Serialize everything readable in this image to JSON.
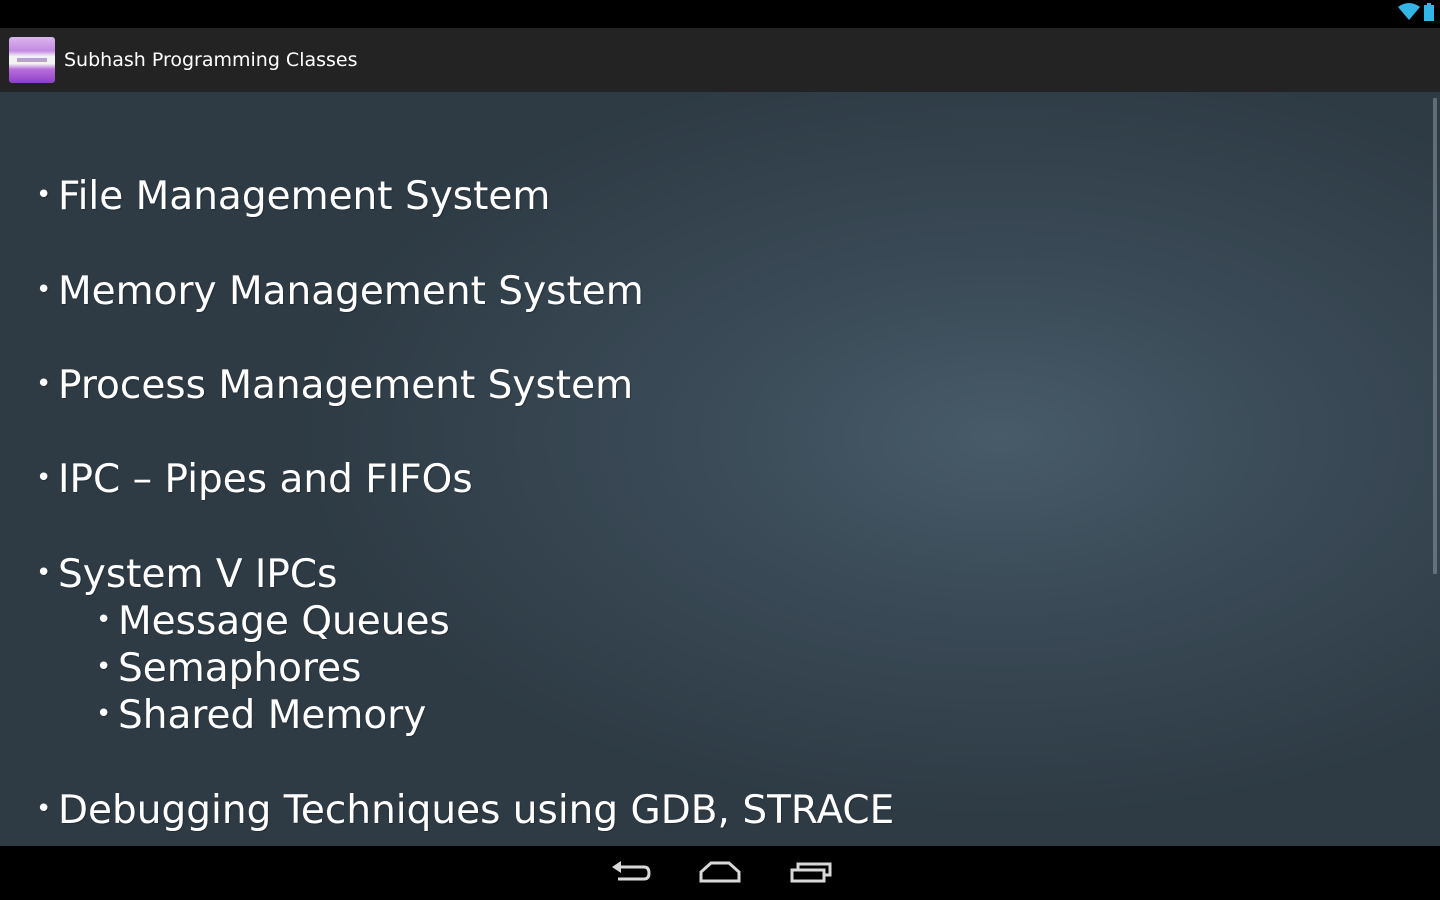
{
  "app": {
    "title": "Subhash Programming Classes"
  },
  "topics": [
    {
      "label": "File Management System"
    },
    {
      "label": "Memory Management System"
    },
    {
      "label": "Process Management System"
    },
    {
      "label": "IPC – Pipes and FIFOs"
    },
    {
      "label": "System V IPCs",
      "children": [
        {
          "label": "Message Queues"
        },
        {
          "label": "Semaphores"
        },
        {
          "label": "Shared Memory"
        }
      ]
    },
    {
      "label": "Debugging Techniques using GDB, STRACE"
    }
  ],
  "bullet": "•",
  "status_bar": {
    "icons": [
      "wifi-icon",
      "battery-icon"
    ]
  },
  "nav_bar": {
    "buttons": [
      "back-icon",
      "home-icon",
      "recent-apps-icon"
    ]
  },
  "colors": {
    "wifi": "#33b5e5",
    "action_bar": "#232323",
    "content_bg": "#3a4a56"
  }
}
